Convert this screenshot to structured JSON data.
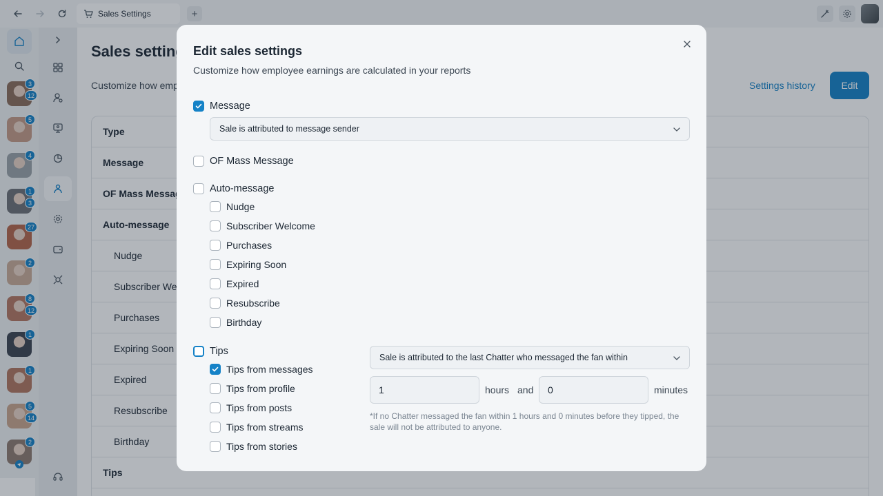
{
  "browser": {
    "tab_title": "Sales Settings",
    "tab_add_icon": "plus-icon",
    "nav_icons": [
      "back-arrow-icon",
      "forward-arrow-icon",
      "reload-icon"
    ],
    "right_icons": [
      "magic-icon",
      "gear-icon"
    ]
  },
  "rail": {
    "nav_icons": [
      "home-icon",
      "search-icon"
    ],
    "models": [
      {
        "badges": [
          "3",
          "12"
        ],
        "color": "#8a6c5a"
      },
      {
        "badges": [
          "5"
        ],
        "color": "#c49a86"
      },
      {
        "badges": [
          "4"
        ],
        "color": "#9aa2a8"
      },
      {
        "badges": [
          "1",
          "3"
        ],
        "color": "#6c7075"
      },
      {
        "badges": [
          "27"
        ],
        "color": "#b4654a"
      },
      {
        "badges": [
          "2"
        ],
        "color": "#c8aa96"
      },
      {
        "badges": [
          "8",
          "12"
        ],
        "color": "#b37660"
      },
      {
        "badges": [
          "1"
        ],
        "color": "#3c4450"
      },
      {
        "badges": [
          "1"
        ],
        "color": "#b0765e"
      },
      {
        "badges": [
          "5",
          "14"
        ],
        "color": "#c9a48c"
      },
      {
        "badges": [
          "2"
        ],
        "color": "#8d7a70"
      }
    ],
    "bottom_icon": "telegram-icon"
  },
  "sidebar": {
    "icons": [
      "expand-icon",
      "apps-grid-icon",
      "user-settings-icon",
      "monitor-user-icon",
      "pie-chart-icon",
      "people-icon",
      "gear-icon",
      "wallet-icon",
      "target-icon"
    ],
    "support_icon": "headset-icon"
  },
  "page": {
    "title": "Sales settings",
    "subtitle": "Customize how employee earnings are calculated in your reports",
    "history_link": "Settings history",
    "edit_button": "Edit",
    "table_rows": [
      {
        "label": "Type",
        "bold": true,
        "sub": false
      },
      {
        "label": "Message",
        "bold": true,
        "sub": false
      },
      {
        "label": "OF Mass Message",
        "bold": true,
        "sub": false
      },
      {
        "label": "Auto-message",
        "bold": true,
        "sub": false
      },
      {
        "label": "Nudge",
        "bold": false,
        "sub": true
      },
      {
        "label": "Subscriber Welcome",
        "bold": false,
        "sub": true
      },
      {
        "label": "Purchases",
        "bold": false,
        "sub": true
      },
      {
        "label": "Expiring Soon",
        "bold": false,
        "sub": true
      },
      {
        "label": "Expired",
        "bold": false,
        "sub": true
      },
      {
        "label": "Resubscribe",
        "bold": false,
        "sub": true
      },
      {
        "label": "Birthday",
        "bold": false,
        "sub": true
      },
      {
        "label": "Tips",
        "bold": true,
        "sub": false
      }
    ]
  },
  "modal": {
    "title": "Edit sales settings",
    "subtitle": "Customize how employee earnings are calculated in your reports",
    "close_icon": "close-icon",
    "message": {
      "label": "Message",
      "checked": true,
      "select_value": "Sale is attributed to message sender"
    },
    "mass_message": {
      "label": "OF Mass Message",
      "checked": false
    },
    "auto_message": {
      "label": "Auto-message",
      "checked": false,
      "items": [
        {
          "label": "Nudge",
          "checked": false
        },
        {
          "label": "Subscriber Welcome",
          "checked": false
        },
        {
          "label": "Purchases",
          "checked": false
        },
        {
          "label": "Expiring Soon",
          "checked": false
        },
        {
          "label": "Expired",
          "checked": false
        },
        {
          "label": "Resubscribe",
          "checked": false
        },
        {
          "label": "Birthday",
          "checked": false
        }
      ]
    },
    "tips": {
      "label": "Tips",
      "checked": false,
      "items": [
        {
          "label": "Tips from messages",
          "checked": true
        },
        {
          "label": "Tips from profile",
          "checked": false
        },
        {
          "label": "Tips from posts",
          "checked": false
        },
        {
          "label": "Tips from streams",
          "checked": false
        },
        {
          "label": "Tips from stories",
          "checked": false
        }
      ],
      "select_value": "Sale is attributed to the last Chatter who messaged the fan within",
      "hours_value": "1",
      "hours_word": "hours",
      "and_word": "and",
      "minutes_value": "0",
      "minutes_word": "minutes",
      "note": "*If no Chatter messaged the fan within 1 hours and 0 minutes before they tipped, the sale will not be attributed to anyone."
    }
  },
  "colors": {
    "accent": "#1582c7",
    "overlay": "rgba(28,40,56,0.34)",
    "modal_bg": "#f4f6f8"
  }
}
